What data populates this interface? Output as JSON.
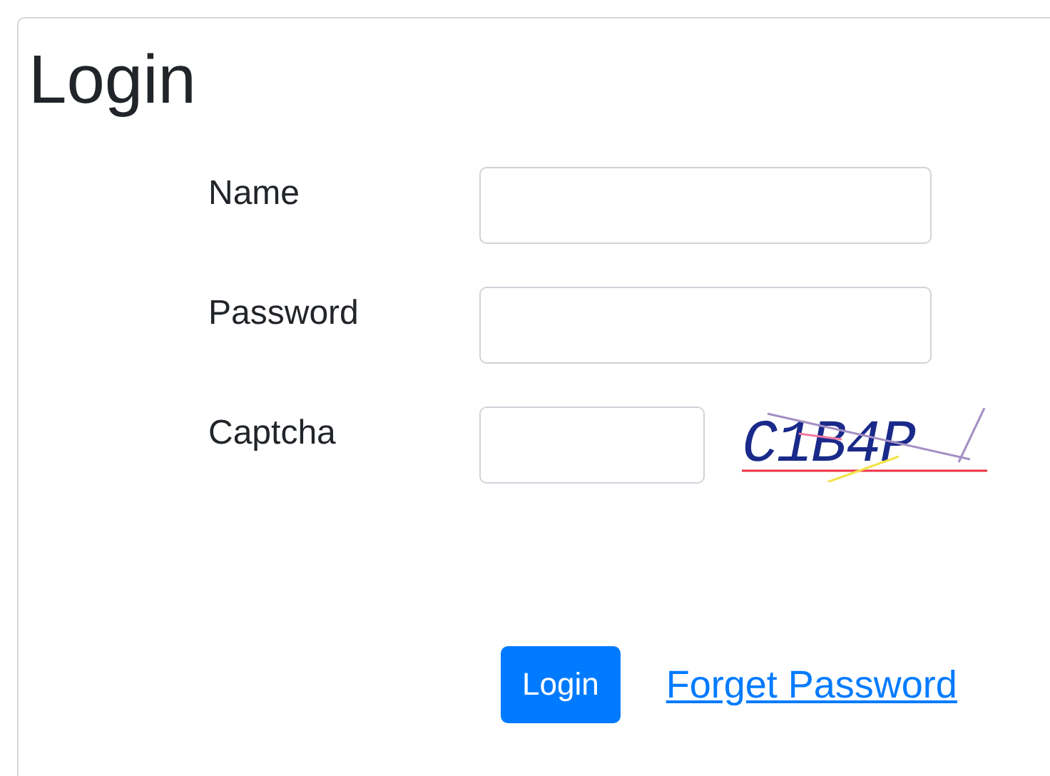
{
  "title": "Login",
  "fields": [
    {
      "label": "Name",
      "kind": "text"
    },
    {
      "label": "Password",
      "kind": "password"
    },
    {
      "label": "Captcha",
      "kind": "captcha"
    }
  ],
  "captcha": {
    "text": "C1B4P"
  },
  "buttons": [
    {
      "label": "Login"
    }
  ],
  "link": {
    "label": "Forget Password"
  }
}
